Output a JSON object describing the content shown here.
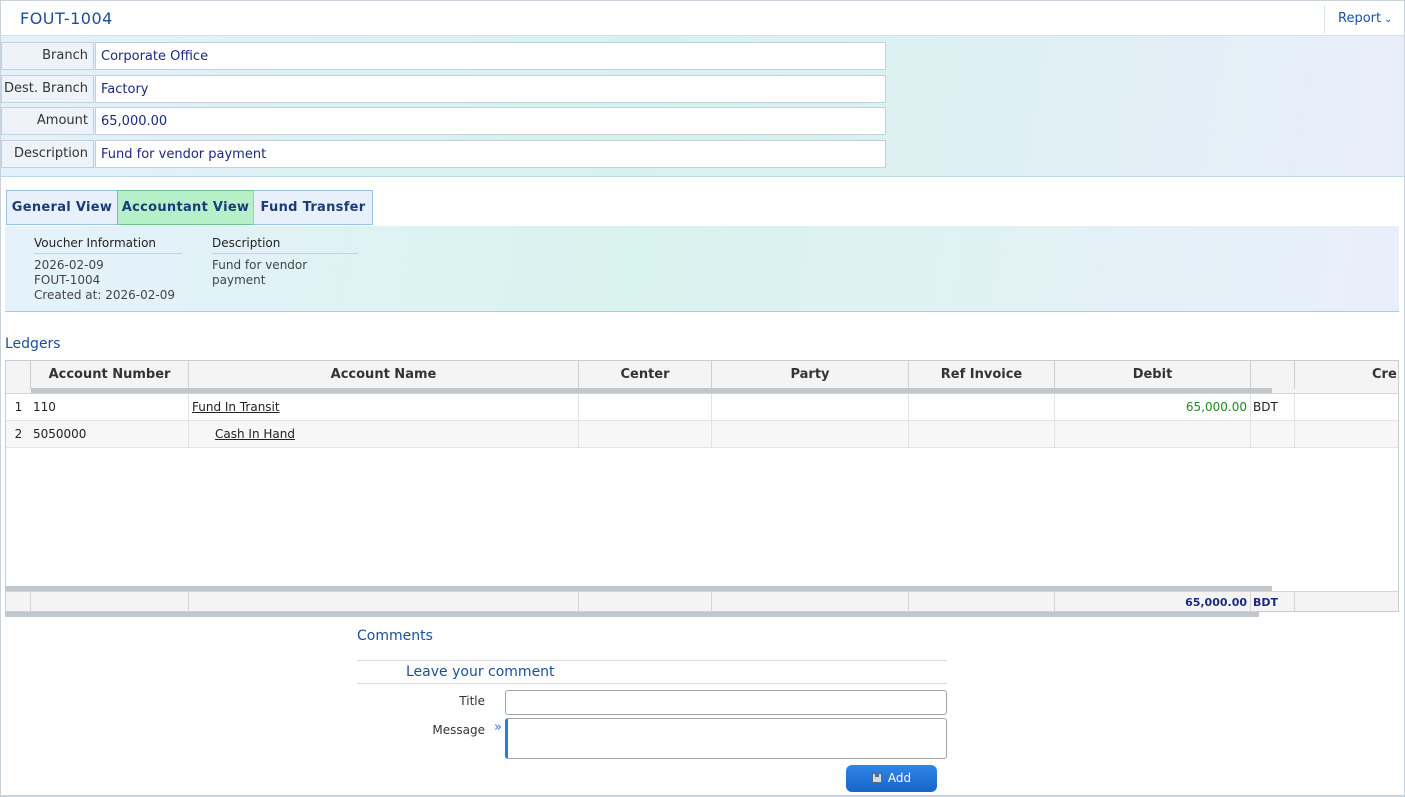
{
  "header": {
    "doc_number": "FOUT-1004",
    "report_label": "Report",
    "report_icon": "chevron-down-icon"
  },
  "form": {
    "branch_label": "Branch",
    "branch_value": "Corporate Office",
    "dest_branch_label": "Dest. Branch",
    "dest_branch_value": "Factory",
    "amount_label": "Amount",
    "amount_value": "65,000.00",
    "description_label": "Description",
    "description_value": "Fund for vendor payment"
  },
  "tabs": [
    {
      "label": "General View",
      "active": false
    },
    {
      "label": "Accountant View",
      "active": true
    },
    {
      "label": "Fund Transfer",
      "active": false
    }
  ],
  "info": {
    "voucher_heading": "Voucher Information",
    "voucher_date": "2026-02-09",
    "voucher_number": "FOUT-1004",
    "created_at": "Created at: 2026-02-09",
    "description_heading": "Description",
    "description_text": "Fund for vendor payment"
  },
  "ledgers": {
    "title": "Ledgers",
    "columns": [
      "Account Number",
      "Account Name",
      "Center",
      "Party",
      "Ref Invoice",
      "Debit",
      "Cre"
    ],
    "rows": [
      {
        "index": "1",
        "account_number": "110",
        "account_name": "Fund In Transit",
        "debit": "65,000.00",
        "currency": "BDT"
      },
      {
        "index": "2",
        "account_number": "5050000",
        "account_name": "Cash In Hand",
        "debit": "",
        "currency": ""
      }
    ],
    "footer_total": "65,000.00",
    "footer_currency": "BDT"
  },
  "comments": {
    "title": "Comments",
    "subtitle": "Leave your comment",
    "title_label": "Title",
    "message_label": "Message",
    "message_icon": "double-chevron-right-icon",
    "add_label": "Add",
    "add_icon": "save-disk-icon"
  },
  "colors": {
    "brand_blue": "#1a4f9c",
    "active_tab": "#b6f0c9",
    "debit_green": "#1f8a1f",
    "button_blue": "#1f74d8"
  }
}
